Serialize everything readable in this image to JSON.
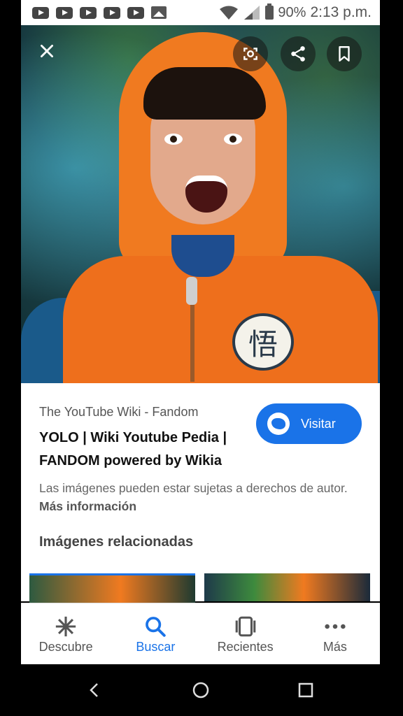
{
  "status_bar": {
    "battery": "90%",
    "time": "2:13 p.m."
  },
  "result": {
    "source": "The YouTube Wiki - Fandom",
    "title": "YOLO | Wiki Youtube Pedia | FANDOM powered by Wikia",
    "visit_label": "Visitar",
    "rights_text": "Las imágenes pueden estar sujetas a derechos de autor.",
    "more_info_label": "Más información",
    "related_heading": "Imágenes relacionadas",
    "emblem_glyph": "悟"
  },
  "bottom_nav": {
    "items": [
      {
        "label": "Descubre",
        "icon": "asterisk-icon"
      },
      {
        "label": "Buscar",
        "icon": "search-icon"
      },
      {
        "label": "Recientes",
        "icon": "recent-cards-icon"
      },
      {
        "label": "Más",
        "icon": "more-dots-icon"
      }
    ],
    "active": "Buscar"
  },
  "colors": {
    "accent": "#1a73e8",
    "hoodie": "#f07a20"
  }
}
